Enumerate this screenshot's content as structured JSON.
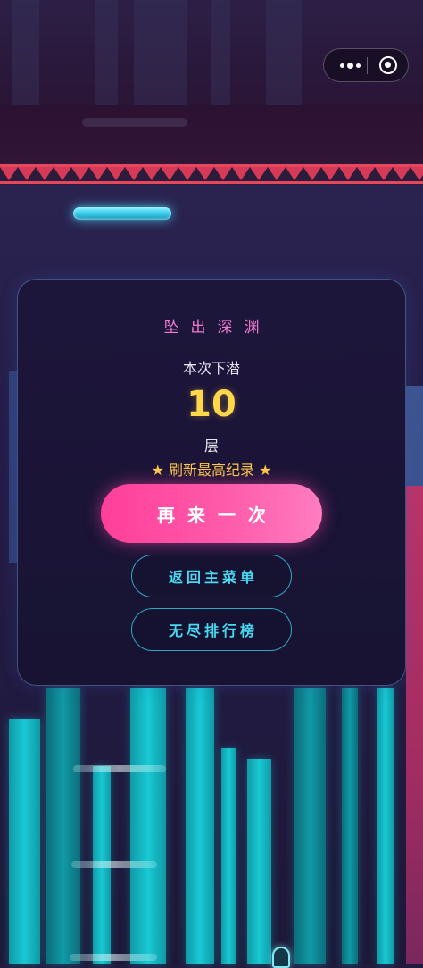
{
  "capsule": {
    "more_icon": "more-dots-icon",
    "close_icon": "record-target-icon"
  },
  "result": {
    "title": "坠出深渊",
    "depth_label": "本次下潜",
    "depth_value": "10",
    "depth_unit": "层",
    "record_text": "★ 刷新最高纪录 ★"
  },
  "buttons": {
    "retry": "再来一次",
    "main_menu": "返回主菜单",
    "leaderboard": "无尽排行榜"
  },
  "colors": {
    "title_pink": "#f27ad0",
    "depth_gold": "#ffd74a",
    "record_gold": "#ffc94a",
    "retry_pink": "#ff4fa3",
    "outline_cyan": "#49d9f2",
    "tower_cyan": "#18c9d4",
    "spike_red": "#e8455f"
  }
}
